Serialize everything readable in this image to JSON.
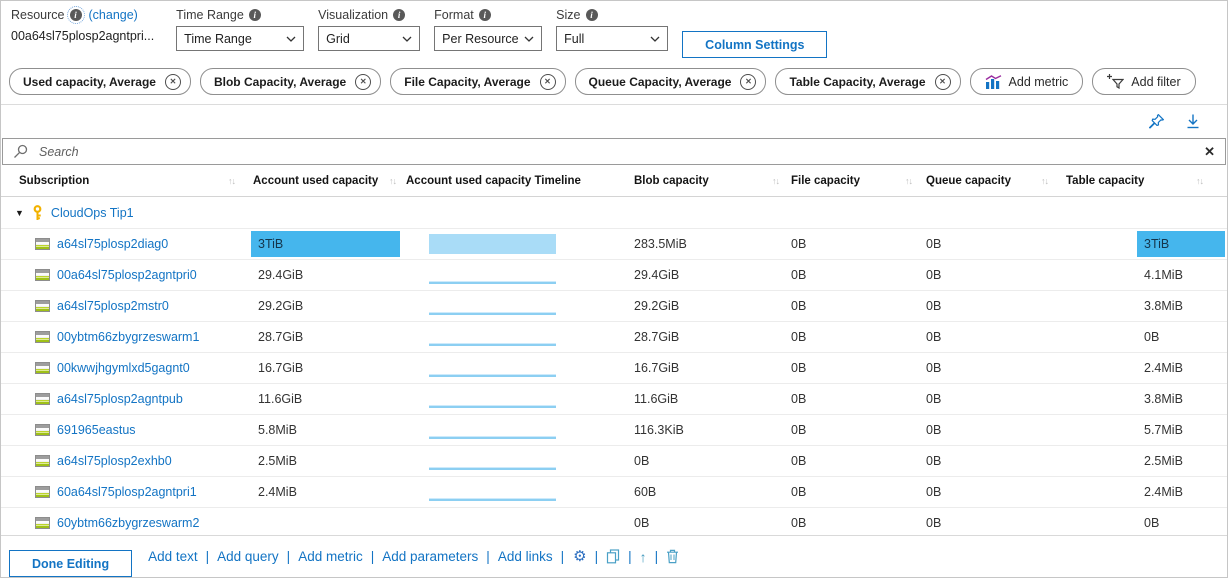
{
  "toolbar": {
    "resource": {
      "label": "Resource",
      "change_label": "(change)",
      "value": "00a64sl75plosp2agntpri..."
    },
    "time_range": {
      "label": "Time Range",
      "value": "Time Range"
    },
    "visualization": {
      "label": "Visualization",
      "value": "Grid"
    },
    "format": {
      "label": "Format",
      "value": "Per Resource"
    },
    "size": {
      "label": "Size",
      "value": "Full"
    },
    "column_settings_label": "Column Settings"
  },
  "metrics_bar": {
    "chips": [
      "Used capacity, Average",
      "Blob Capacity, Average",
      "File Capacity, Average",
      "Queue Capacity, Average",
      "Table Capacity, Average"
    ],
    "add_metric_label": "Add metric",
    "add_filter_label": "Add filter"
  },
  "search": {
    "placeholder": "Search"
  },
  "table": {
    "columns": [
      {
        "label": "Subscription",
        "sortable": true
      },
      {
        "label": "Account used capacity",
        "sortable": true
      },
      {
        "label": "Account used capacity Timeline",
        "sortable": false
      },
      {
        "label": "Blob capacity",
        "sortable": true
      },
      {
        "label": "File capacity",
        "sortable": true
      },
      {
        "label": "Queue capacity",
        "sortable": true
      },
      {
        "label": "Table capacity",
        "sortable": true
      }
    ],
    "group_name": "CloudOps Tip1",
    "rows": [
      {
        "name": "a64sl75plosp2diag0",
        "account_used": "3TiB",
        "used_bar": true,
        "timeline": "block",
        "blob": "283.5MiB",
        "file": "0B",
        "queue": "0B",
        "table": "3TiB",
        "table_bar": true
      },
      {
        "name": "00a64sl75plosp2agntpri0",
        "account_used": "29.4GiB",
        "used_bar": false,
        "timeline": "line",
        "blob": "29.4GiB",
        "file": "0B",
        "queue": "0B",
        "table": "4.1MiB",
        "table_bar": false
      },
      {
        "name": "a64sl75plosp2mstr0",
        "account_used": "29.2GiB",
        "used_bar": false,
        "timeline": "line",
        "blob": "29.2GiB",
        "file": "0B",
        "queue": "0B",
        "table": "3.8MiB",
        "table_bar": false
      },
      {
        "name": "00ybtm66zbygrzeswarm1",
        "account_used": "28.7GiB",
        "used_bar": false,
        "timeline": "line",
        "blob": "28.7GiB",
        "file": "0B",
        "queue": "0B",
        "table": "0B",
        "table_bar": false
      },
      {
        "name": "00kwwjhgymlxd5gagnt0",
        "account_used": "16.7GiB",
        "used_bar": false,
        "timeline": "line",
        "blob": "16.7GiB",
        "file": "0B",
        "queue": "0B",
        "table": "2.4MiB",
        "table_bar": false
      },
      {
        "name": "a64sl75plosp2agntpub",
        "account_used": "11.6GiB",
        "used_bar": false,
        "timeline": "line",
        "blob": "11.6GiB",
        "file": "0B",
        "queue": "0B",
        "table": "3.8MiB",
        "table_bar": false
      },
      {
        "name": "691965eastus",
        "account_used": "5.8MiB",
        "used_bar": false,
        "timeline": "line",
        "blob": "116.3KiB",
        "file": "0B",
        "queue": "0B",
        "table": "5.7MiB",
        "table_bar": false
      },
      {
        "name": "a64sl75plosp2exhb0",
        "account_used": "2.5MiB",
        "used_bar": false,
        "timeline": "line",
        "blob": "0B",
        "file": "0B",
        "queue": "0B",
        "table": "2.5MiB",
        "table_bar": false
      },
      {
        "name": "60a64sl75plosp2agntpri1",
        "account_used": "2.4MiB",
        "used_bar": false,
        "timeline": "line",
        "blob": "60B",
        "file": "0B",
        "queue": "0B",
        "table": "2.4MiB",
        "table_bar": false
      },
      {
        "name": "60ybtm66zbygrzeswarm2",
        "account_used": "",
        "used_bar": false,
        "timeline": "none",
        "blob": "0B",
        "file": "0B",
        "queue": "0B",
        "table": "0B",
        "table_bar": false
      }
    ]
  },
  "footer": {
    "done_button_label": "Done Editing",
    "links": [
      "Add text",
      "Add query",
      "Add metric",
      "Add parameters",
      "Add links"
    ]
  },
  "icons": {
    "info": "i",
    "chip_close": "✕",
    "clear": "✕",
    "sort": "↑↓",
    "expand": "▼",
    "gear": "⚙",
    "up_arrow": "↑",
    "separator": "|"
  },
  "colors": {
    "accent_blue": "#1374c4",
    "heatmap_bar": "#45b6ed",
    "timeline_fill": "#a9dcf7"
  }
}
